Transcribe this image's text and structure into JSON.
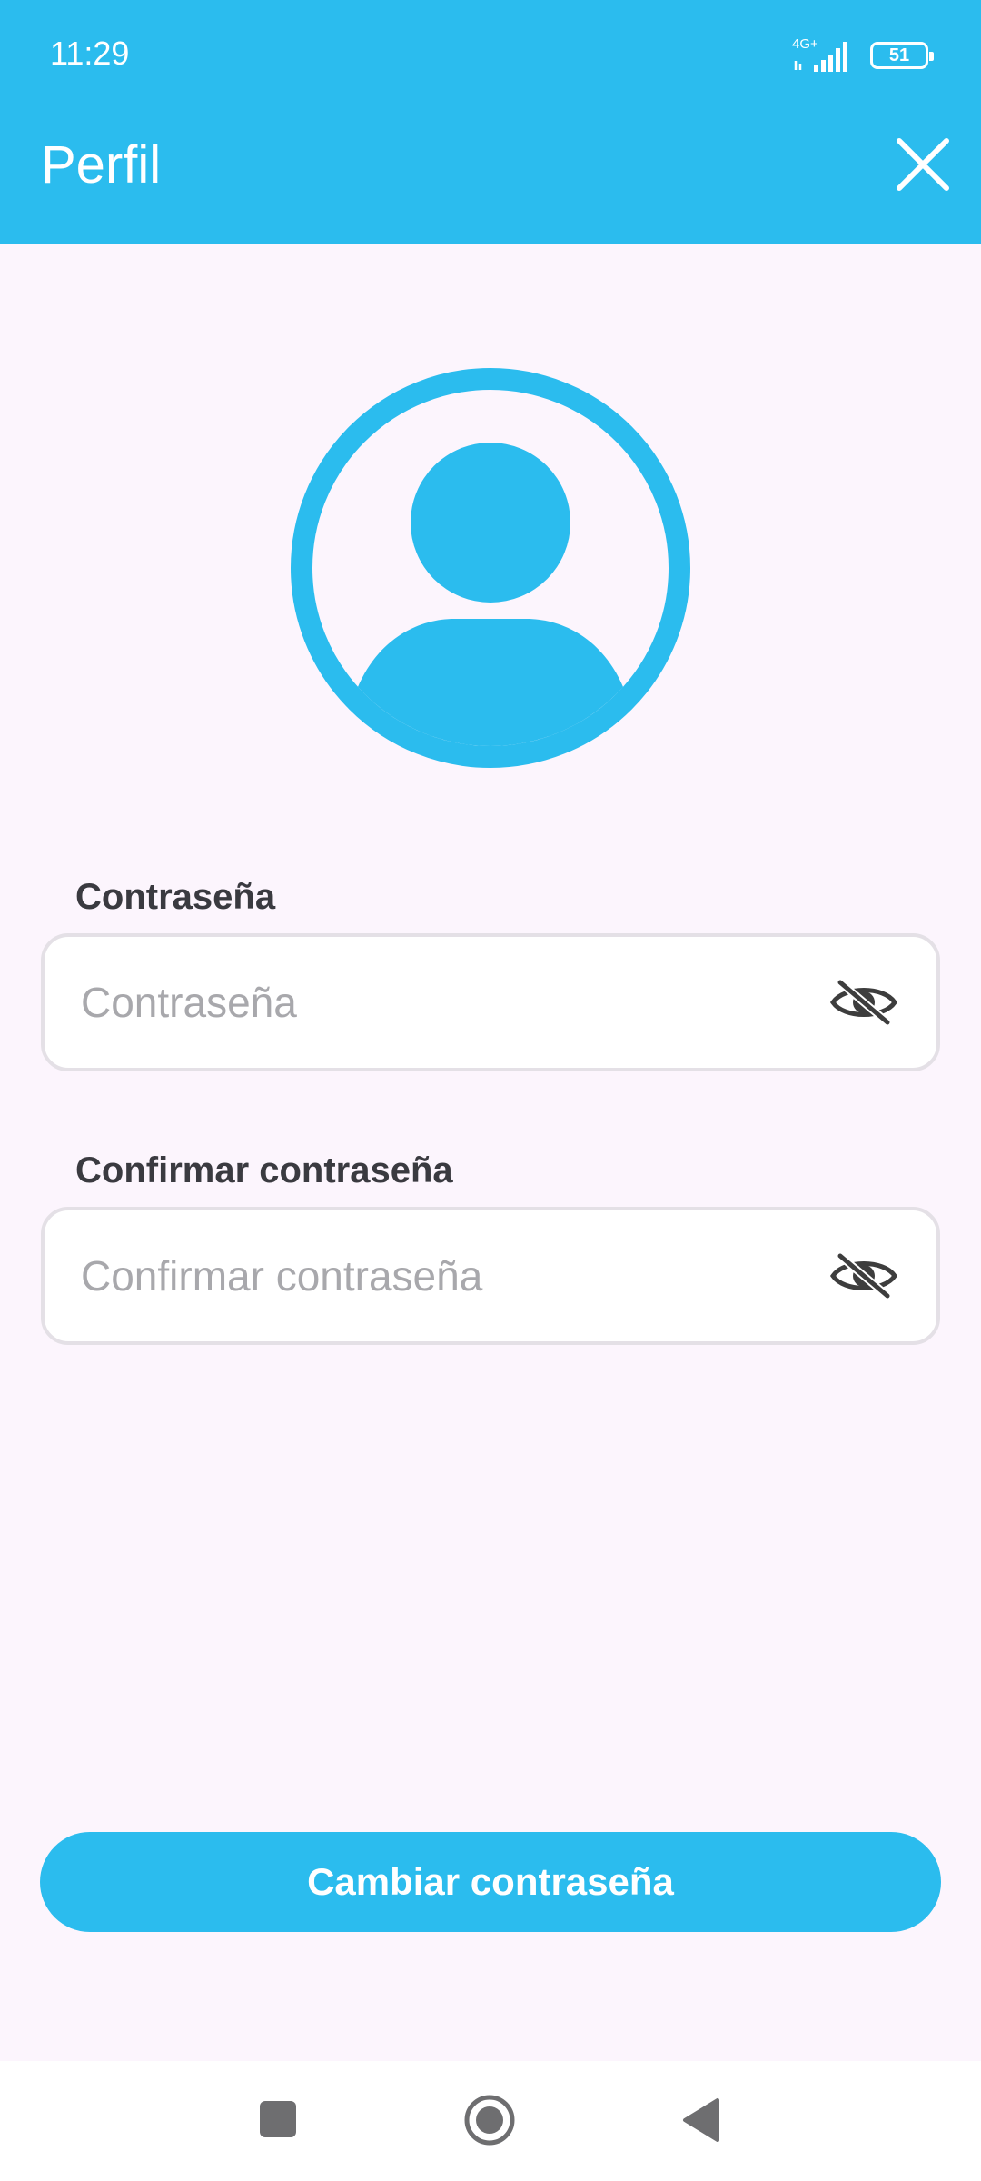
{
  "status_bar": {
    "time": "11:29",
    "network": "4G+",
    "battery": "51"
  },
  "header": {
    "title": "Perfil",
    "close_icon": "close-icon"
  },
  "avatar_icon": "user-avatar-icon",
  "form": {
    "password": {
      "label": "Contraseña",
      "placeholder": "Contraseña",
      "value": "",
      "toggle_icon": "eye-off-icon"
    },
    "confirm_password": {
      "label": "Confirmar contraseña",
      "placeholder": "Confirmar contraseña",
      "value": "",
      "toggle_icon": "eye-off-icon"
    },
    "submit_label": "Cambiar contraseña"
  },
  "navigation": {
    "recents_icon": "square-icon",
    "home_icon": "circle-icon",
    "back_icon": "triangle-back-icon"
  },
  "colors": {
    "accent": "#2bbcee",
    "background": "#fcf5fd",
    "label": "#3a3a40",
    "placeholder": "#a8a8ac"
  }
}
